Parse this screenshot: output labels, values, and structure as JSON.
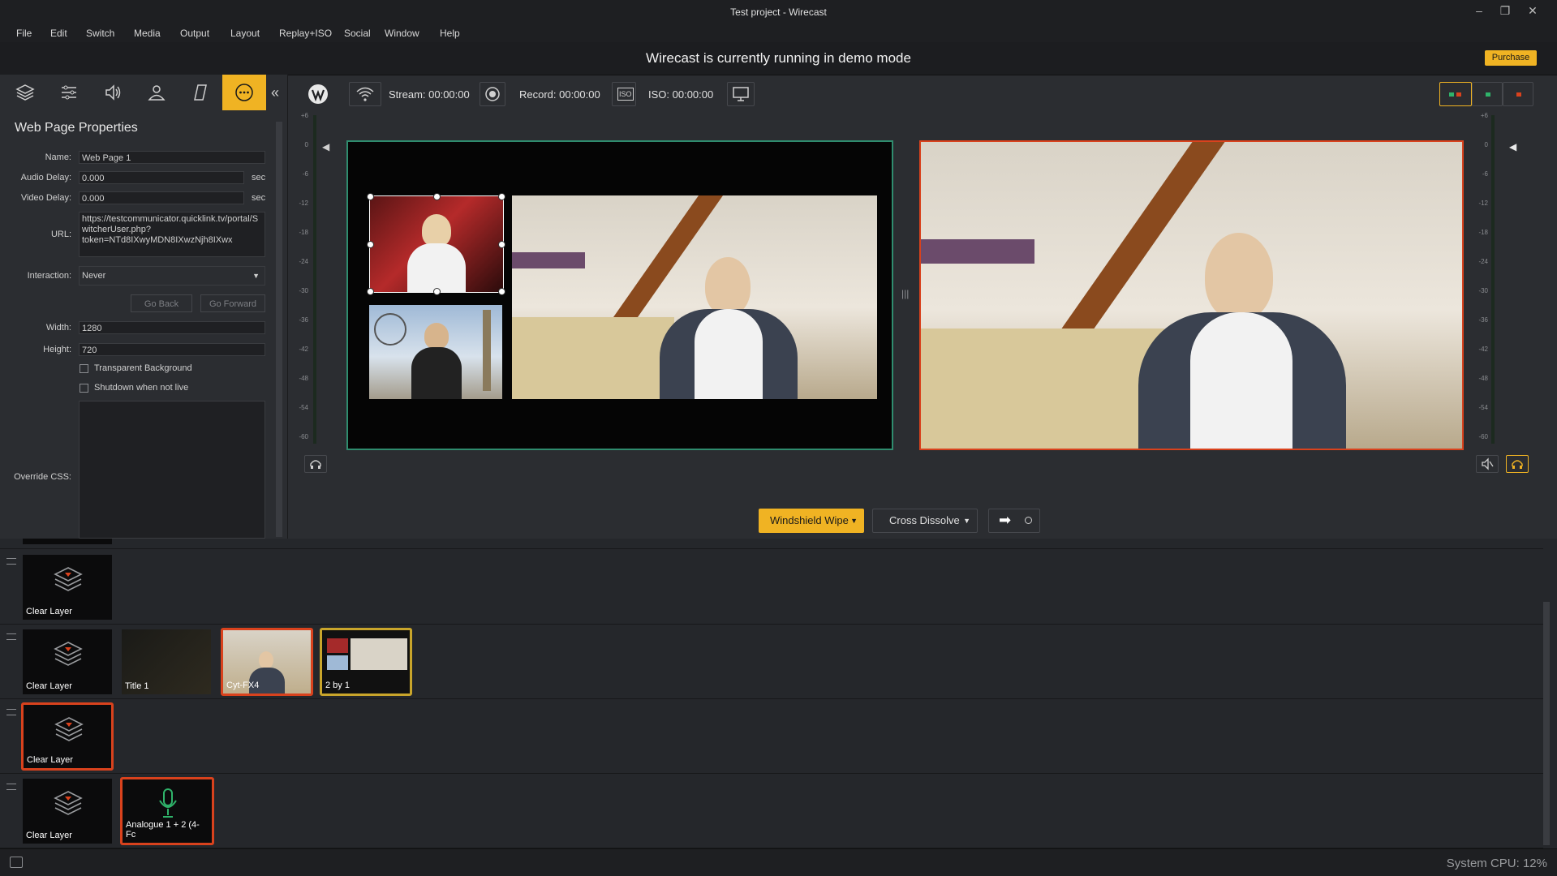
{
  "window": {
    "title": "Test project - Wirecast",
    "controls": [
      "minimize-icon",
      "restore-icon",
      "close-icon"
    ]
  },
  "menubar": [
    "File",
    "Edit",
    "Switch",
    "Media",
    "Output",
    "Layout",
    "Replay+ISO",
    "Social",
    "Window",
    "Help"
  ],
  "demo": {
    "message": "Wirecast is currently running in demo mode",
    "purchase_label": "Purchase"
  },
  "left_tabs": [
    "layers-icon",
    "sliders-icon",
    "audio-icon",
    "person-icon",
    "skew-icon",
    "more-icon"
  ],
  "properties": {
    "title": "Web Page Properties",
    "name_label": "Name:",
    "name_value": "Web Page 1",
    "audio_delay_label": "Audio Delay:",
    "audio_delay_value": "0.000",
    "video_delay_label": "Video Delay:",
    "video_delay_value": "0.000",
    "unit_sec": "sec",
    "url_label": "URL:",
    "url_line1": "https://testcommunicator.quicklink.tv/portal/S",
    "url_line2": "witcherUser.php?",
    "url_line3": "token=NTd8IXwyMDN8IXwzNjh8IXwx",
    "interaction_label": "Interaction:",
    "interaction_value": "Never",
    "go_back": "Go Back",
    "go_forward": "Go Forward",
    "width_label": "Width:",
    "width_value": "1280",
    "height_label": "Height:",
    "height_value": "720",
    "transparent_bg": "Transparent Background",
    "shutdown": "Shutdown when not live",
    "override_css_label": "Override CSS:"
  },
  "toolbar": {
    "stream": "Stream: 00:00:00",
    "record": "Record: 00:00:00",
    "iso": "ISO: 00:00:00",
    "iso_badge": "ISO"
  },
  "meter_scale": [
    "+6",
    "0",
    "-6",
    "-12",
    "-18",
    "-24",
    "-30",
    "-36",
    "-42",
    "-48",
    "-54",
    "-60"
  ],
  "transitions": {
    "primary": "Windshield Wipe",
    "secondary": "Cross Dissolve"
  },
  "layers": {
    "row1": [
      {
        "label": "Clear Layer"
      }
    ],
    "row2": [
      {
        "label": "Clear Layer"
      },
      {
        "label": "Title 1"
      },
      {
        "label": "Cyt-FX4"
      },
      {
        "label": "2 by 1"
      }
    ],
    "row3": [
      {
        "label": "Clear Layer"
      }
    ],
    "row4": [
      {
        "label": "Clear Layer"
      },
      {
        "label": "Analogue 1 + 2 (4- Fc"
      }
    ]
  },
  "status": {
    "cpu": "System CPU:  12%"
  },
  "colors": {
    "accent": "#f0b323",
    "live": "#d9421d",
    "preview": "#2f8c6e"
  }
}
